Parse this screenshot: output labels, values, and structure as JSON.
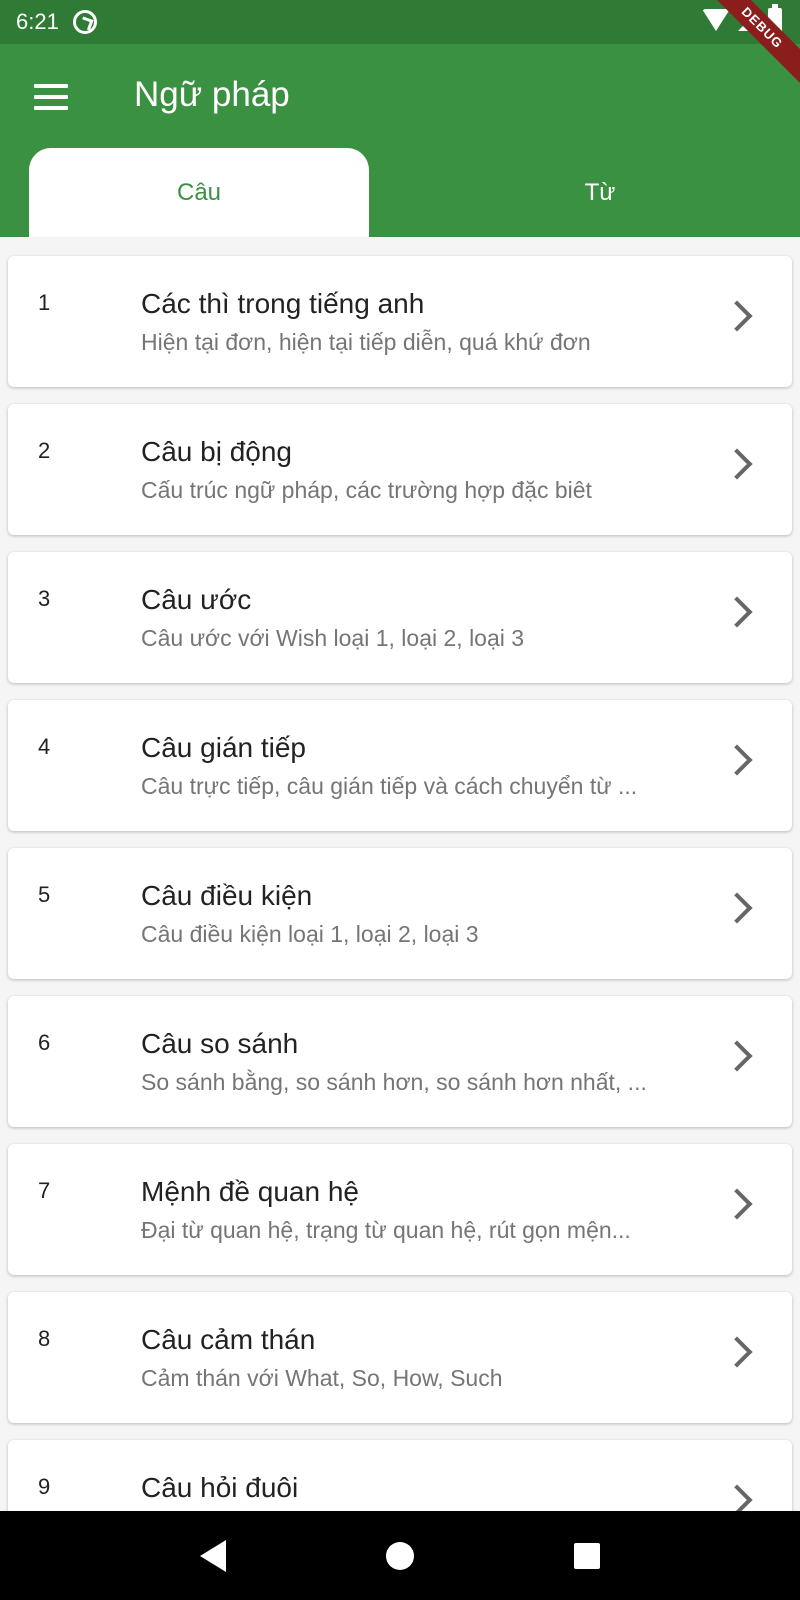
{
  "status_bar": {
    "time": "6:21"
  },
  "debug_banner": "DEBUG",
  "app_bar": {
    "title": "Ngữ pháp"
  },
  "tabs": [
    {
      "label": "Câu",
      "selected": true
    },
    {
      "label": "Từ",
      "selected": false
    }
  ],
  "lessons": [
    {
      "number": "1",
      "title": "Các thì trong tiếng anh",
      "subtitle": "Hiện tại đơn, hiện tại tiếp diễn, quá khứ đơn"
    },
    {
      "number": "2",
      "title": "Câu bị động",
      "subtitle": "Cấu trúc ngữ pháp, các trường hợp đặc biêt"
    },
    {
      "number": "3",
      "title": "Câu ước",
      "subtitle": "Câu ước với Wish loại 1, loại 2, loại 3"
    },
    {
      "number": "4",
      "title": "Câu gián tiếp",
      "subtitle": "Câu trực tiếp, câu gián tiếp và cách chuyển từ ..."
    },
    {
      "number": "5",
      "title": "Câu điều kiện",
      "subtitle": "Câu điều kiện loại 1, loại 2, loại 3"
    },
    {
      "number": "6",
      "title": "Câu so sánh",
      "subtitle": "So sánh bằng, so sánh hơn, so sánh hơn nhất, ..."
    },
    {
      "number": "7",
      "title": "Mệnh đề quan hệ",
      "subtitle": "Đại từ quan hệ, trạng từ quan hệ, rút gọn mện..."
    },
    {
      "number": "8",
      "title": "Câu cảm thán",
      "subtitle": "Cảm thán với What, So, How, Such"
    },
    {
      "number": "9",
      "title": "Câu hỏi đuôi",
      "subtitle": ""
    }
  ],
  "colors": {
    "primary": "#3b9142",
    "status_bar": "#2f7a35"
  }
}
